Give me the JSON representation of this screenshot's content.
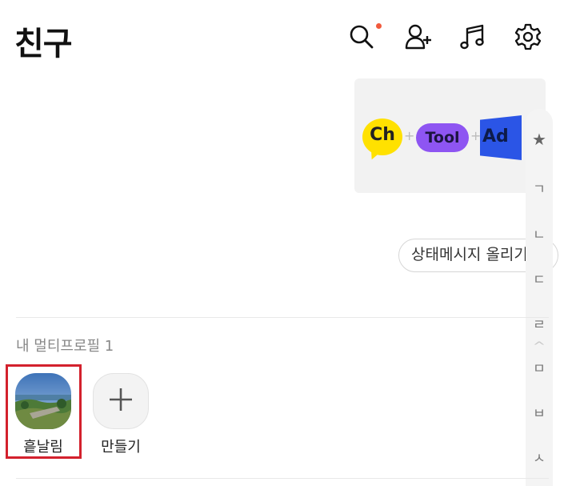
{
  "header": {
    "title": "친구",
    "icons": [
      "search-icon",
      "add-friend-icon",
      "music-icon",
      "settings-icon"
    ],
    "notification_dot_color": "#f15a3c"
  },
  "banner": {
    "ch": "Ch",
    "tool": "Tool",
    "ad": "Ad",
    "plus": "+"
  },
  "status_button": {
    "label": "상태메시지 올리기"
  },
  "index_bar": {
    "items": [
      "★",
      "ㄱ",
      "ㄴ",
      "ㄷ",
      "ㄹ",
      "ㅁ",
      "ㅂ",
      "ㅅ"
    ]
  },
  "multi_profile": {
    "section_label": "내 멀티프로필 1",
    "profiles": [
      {
        "name": "흩날림"
      }
    ],
    "create_label": "만들기"
  },
  "colors": {
    "highlight": "#d3212d",
    "ch_yellow": "#ffe100",
    "tool_purple": "#8e55f2",
    "ad_blue": "#2b55e6"
  }
}
